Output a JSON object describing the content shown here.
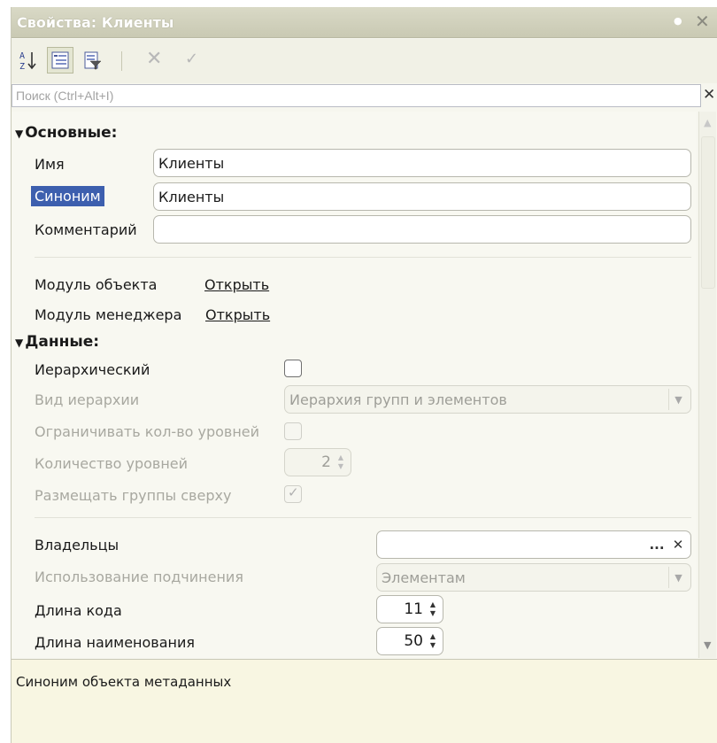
{
  "window": {
    "title": "Свойства: Клиенты"
  },
  "toolbar": {
    "sort_icon": "sort-az-icon",
    "categories_icon": "categories-icon",
    "filter_icon": "filter-icon",
    "cancel_icon": "cancel-icon",
    "apply_icon": "apply-icon"
  },
  "search": {
    "placeholder": "Поиск (Ctrl+Alt+I)"
  },
  "basic": {
    "section_label": "Основные:",
    "name_label": "Имя",
    "name_value": "Клиенты",
    "synonym_label": "Синоним",
    "synonym_value": "Клиенты",
    "comment_label": "Комментарий",
    "comment_value": "",
    "object_module_label": "Модуль объекта",
    "object_module_link": "Открыть",
    "manager_module_label": "Модуль менеджера",
    "manager_module_link": "Открыть"
  },
  "data": {
    "section_label": "Данные:",
    "hierarchical_label": "Иерархический",
    "hierarchy_type_label": "Вид иерархии",
    "hierarchy_type_value": "Иерархия групп и элементов",
    "limit_levels_label": "Ограничивать кол-во уровней",
    "levels_count_label": "Количество уровней",
    "levels_count_value": "2",
    "groups_top_label": "Размещать группы сверху",
    "owners_label": "Владельцы",
    "owners_value": "",
    "owners_select": "...",
    "subordination_label": "Использование подчинения",
    "subordination_value": "Элементам",
    "code_length_label": "Длина кода",
    "code_length_value": "11",
    "name_length_label": "Длина наименования",
    "name_length_value": "50"
  },
  "description": {
    "text": "Синоним объекта метаданных"
  }
}
